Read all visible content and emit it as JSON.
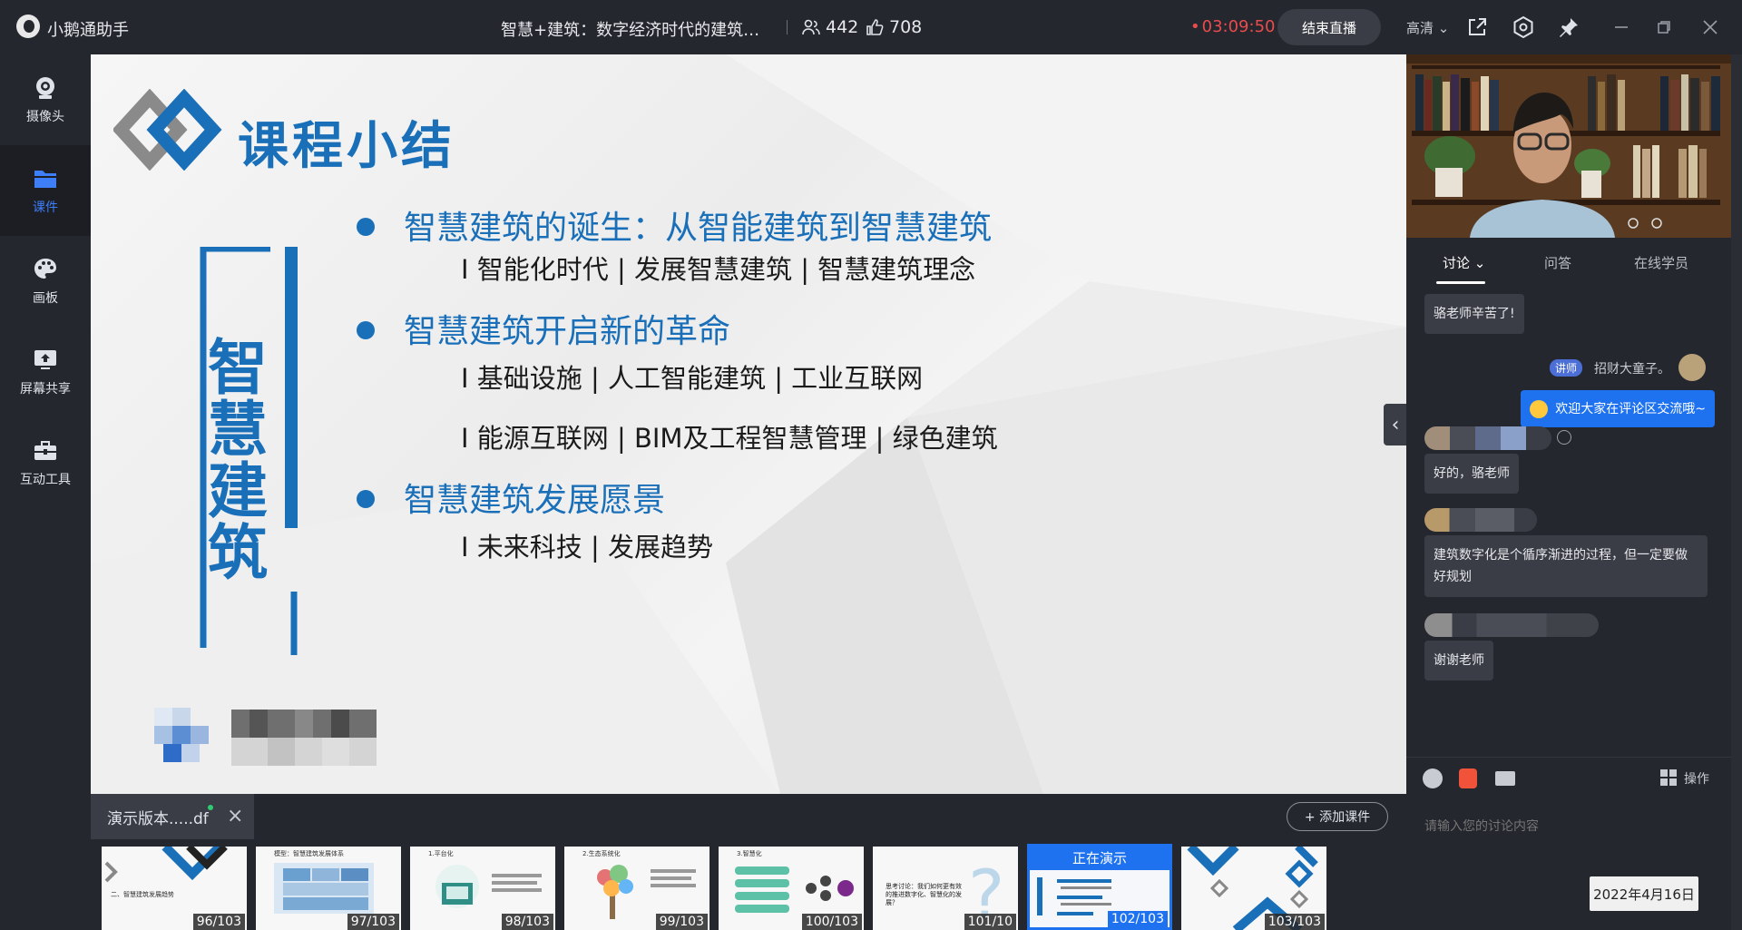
{
  "app": {
    "name": "小鹅通助手",
    "course_title": "智慧+建筑：数字经济时代的建筑业...",
    "viewers": "442",
    "likes": "708",
    "live_time": "03:09:50",
    "end_live_label": "结束直播",
    "quality": "高清"
  },
  "sidebar": {
    "items": [
      {
        "label": "摄像头",
        "icon": "camera-icon"
      },
      {
        "label": "课件",
        "icon": "folder-icon"
      },
      {
        "label": "画板",
        "icon": "palette-icon"
      },
      {
        "label": "屏幕共享",
        "icon": "screen-share-icon"
      },
      {
        "label": "互动工具",
        "icon": "toolbox-icon"
      }
    ]
  },
  "slide": {
    "title": "课程小结",
    "vertical_text": "智慧建筑",
    "bullets": [
      {
        "heading": "智慧建筑的诞生：从智能建筑到智慧建筑",
        "subs": [
          "I 智能化时代 | 发展智慧建筑 | 智慧建筑理念"
        ]
      },
      {
        "heading": "智慧建筑开启新的革命",
        "subs": [
          "I 基础设施 | 人工智能建筑 | 工业互联网",
          "I 能源互联网 | BIM及工程智慧管理 | 绿色建筑"
        ]
      },
      {
        "heading": "智慧建筑发展愿景",
        "subs": [
          "I 未来科技 | 发展趋势"
        ]
      }
    ]
  },
  "tray": {
    "doc_name": "演示版本.....df",
    "add_course_label": "+ 添加课件",
    "now_presenting_label": "正在演示",
    "thumbnails": [
      {
        "num": "96/103",
        "caption": "二、智慧建筑发展趋势"
      },
      {
        "num": "97/103",
        "caption": "模型：智慧建筑发展体系"
      },
      {
        "num": "98/103",
        "caption": "1.平台化"
      },
      {
        "num": "99/103",
        "caption": "2.生态系统化"
      },
      {
        "num": "100/103",
        "caption": "3.智慧化"
      },
      {
        "num": "101/10",
        "caption": "思考讨论：我们如何更有效的推进数字化、智慧化的发展？"
      },
      {
        "num": "102/103",
        "caption": ""
      },
      {
        "num": "103/103",
        "caption": ""
      }
    ]
  },
  "panel": {
    "tabs": [
      "讨论",
      "问答",
      "在线学员"
    ],
    "messages": {
      "m1": "骆老师辛苦了!",
      "teacher_tag": "讲师",
      "teacher_name": "招财大童子。",
      "own": "欢迎大家在评论区交流哦~",
      "m2": "好的，骆老师",
      "m3": "建筑数字化是个循序渐进的过程，但一定要做好规划",
      "m4": "谢谢老师"
    },
    "operate_label": "操作",
    "input_placeholder": "请输入您的讨论内容",
    "date": "2022年4月16日"
  },
  "colors": {
    "accent": "#1e72f0",
    "slide_blue": "#1a6fb9",
    "live_red": "#e84c4c"
  }
}
